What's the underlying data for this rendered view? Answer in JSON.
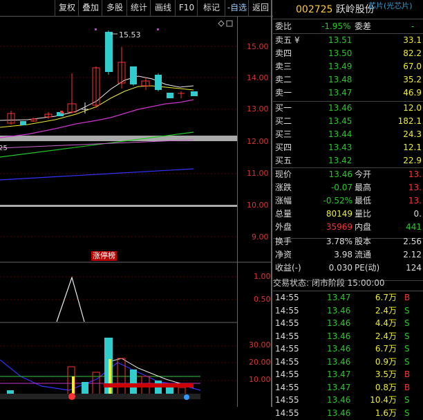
{
  "toolbar": {
    "buttons": [
      "复权",
      "叠加",
      "多股",
      "统计",
      "画线",
      "F10",
      "标记",
      "-自选",
      "返回"
    ]
  },
  "chart": {
    "price_axis": [
      "15.00",
      "14.00",
      "13.00",
      "12.00",
      "11.00",
      "10.00",
      "9.00"
    ],
    "indicator_axis": [
      "1.00",
      "0.50"
    ],
    "volume_axis": [
      "30.00",
      "20.00",
      "10.00"
    ],
    "high_label": "15.53",
    "left_edge_label": "25",
    "badge": "涨停榜"
  },
  "quote": {
    "code": "002725",
    "name": "跃岭股份",
    "sector": "芯片(光芯片)",
    "weibi_label": "委比",
    "weibi_value": "-1.95%",
    "weicha_label": "委差",
    "weicha_value": "-",
    "sells": [
      {
        "label": "卖五",
        "price": "13.51",
        "vol": "33.1"
      },
      {
        "label": "卖四",
        "price": "13.50",
        "vol": "82.2"
      },
      {
        "label": "卖三",
        "price": "13.49",
        "vol": "67.0"
      },
      {
        "label": "卖二",
        "price": "13.48",
        "vol": "35.2"
      },
      {
        "label": "卖一",
        "price": "13.47",
        "vol": "46.9"
      }
    ],
    "sell_mark": "¥",
    "buys": [
      {
        "label": "买一",
        "price": "13.46",
        "vol": "12.0"
      },
      {
        "label": "买二",
        "price": "13.45",
        "vol": "182.1"
      },
      {
        "label": "买三",
        "price": "13.44",
        "vol": "24.3"
      },
      {
        "label": "买四",
        "price": "13.43",
        "vol": "12.1"
      },
      {
        "label": "买五",
        "price": "13.42",
        "vol": "22.9"
      }
    ],
    "stats": [
      {
        "l1": "现价",
        "v1": "13.46",
        "l2": "今开",
        "v2": "13."
      },
      {
        "l1": "涨跌",
        "v1": "-0.07",
        "l2": "最高",
        "v2": "13."
      },
      {
        "l1": "涨幅",
        "v1": "-0.52%",
        "l2": "最低",
        "v2": "13."
      },
      {
        "l1": "总量",
        "v1": "80149",
        "l2": "量比",
        "v2": "0."
      },
      {
        "l1": "外盘",
        "v1": "35969",
        "l2": "内盘",
        "v2": "441"
      }
    ],
    "stats2": [
      {
        "l1": "换手",
        "v1": "3.78%",
        "l2": "股本",
        "v2": "2.56"
      },
      {
        "l1": "净资",
        "v1": "3.98",
        "l2": "流通",
        "v2": "2.12"
      },
      {
        "l1": "收益(-)",
        "v1": "0.030",
        "l2": "PE(动)",
        "v2": "124"
      }
    ],
    "trade_status": "交易状态: 闭市阶段 15:00:00",
    "ticks": [
      {
        "t": "14:55",
        "p": "13.47",
        "v": "6.7万",
        "d": "B"
      },
      {
        "t": "14:55",
        "p": "13.46",
        "v": "2.4万",
        "d": "S"
      },
      {
        "t": "14:55",
        "p": "13.46",
        "v": "4.4万",
        "d": "S"
      },
      {
        "t": "14:55",
        "p": "13.46",
        "v": "2.4万",
        "d": "S"
      },
      {
        "t": "14:55",
        "p": "13.46",
        "v": "6.7万",
        "d": "S"
      },
      {
        "t": "14:55",
        "p": "13.46",
        "v": "0.9万",
        "d": "S"
      },
      {
        "t": "14:55",
        "p": "13.47",
        "v": "3.5万",
        "d": "B"
      },
      {
        "t": "14:55",
        "p": "13.47",
        "v": "0.8万",
        "d": "B"
      },
      {
        "t": "14:55",
        "p": "13.46",
        "v": "10.4万",
        "d": "S"
      },
      {
        "t": "14:55",
        "p": "13.46",
        "v": "1.6万",
        "d": "S"
      }
    ]
  }
}
